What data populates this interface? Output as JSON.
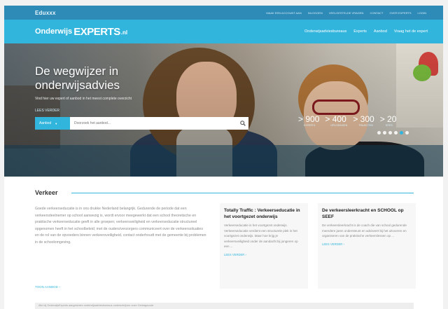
{
  "topbar": {
    "logo": "Eduxxx",
    "links": [
      "Maak een account aan",
      "Inloggen",
      "Veelgestelde vragen",
      "Contact",
      "Over Experts",
      "Login"
    ]
  },
  "nav": {
    "brand_a": "Onderwijs",
    "brand_b": "EXPERTS",
    "brand_c": ".nl",
    "links": [
      "Onderwijsadviesbureaus",
      "Experts",
      "Aanbod",
      "Vraag het de expert"
    ]
  },
  "hero": {
    "title_line1": "De wegwijzer in",
    "title_line2": "onderwijsadvies",
    "subtitle": "Vind hier uw expert of aanbod in het meest complete overzicht",
    "more": "Lees verder",
    "slide_count": 6,
    "active_slide": 4
  },
  "search": {
    "select_label": "Aanbod",
    "placeholder": "Doorzoek het aanbod..."
  },
  "stats": [
    {
      "num": "> 900",
      "label": "Experts"
    },
    {
      "num": "> 400",
      "label": "Opleidingen"
    },
    {
      "num": "> 300",
      "label": "Trajecten"
    },
    {
      "num": "> 20",
      "label": "Sites"
    }
  ],
  "section": {
    "title": "Verkeer",
    "intro": "Goede verkeerseducatie is in ons drukke Nederland belangrijk. Gedurende de periode dat een verkeersdeelnemer op school aanwezig is, wordt ervoor meegewerkt dat een school theoretische en praktische verkeerseducatie geeft in alle groepen; verkeersveiligheid en verkeerseducatie structureel opgenomen heeft in het schoolbeleid; met de ouders/verzorgers communiceert over de verkeerssituaties en de rol van de opvoeders binnen verkeersveiligheid, contact onderhoudt met de gemeente bij problemen in de schoolomgeving.",
    "intro_link": "Toon aanbod"
  },
  "cards": [
    {
      "title": "Totally Traffic : Verkeerseducatie in het voortgezet onderwijs",
      "text": "Verkeerseducatie in het voortgezet onderwijs. Verkeerseducatie verdient een structurele plek in het voortgezet onderwijs. Maar hoe krijg je verkeersveiligheid onder de aandacht bij jongeren op een ...",
      "link": "Lees verder"
    },
    {
      "title": "De verkeersleerkracht en SCHOOL op SEEF",
      "text": "De verkeersleerkracht is de coach die van school gedurende meerdere jaren ondersteunt en adviseert bij het uitvoeren en organiseren van de praktische verkeerslessen op ...",
      "link": "Lees verder"
    }
  ],
  "footer": {
    "text": "Alle bij OnderwijsExperts aangesloten onderwijsadviesbureaus onderschrijven onze Gedragscode"
  }
}
